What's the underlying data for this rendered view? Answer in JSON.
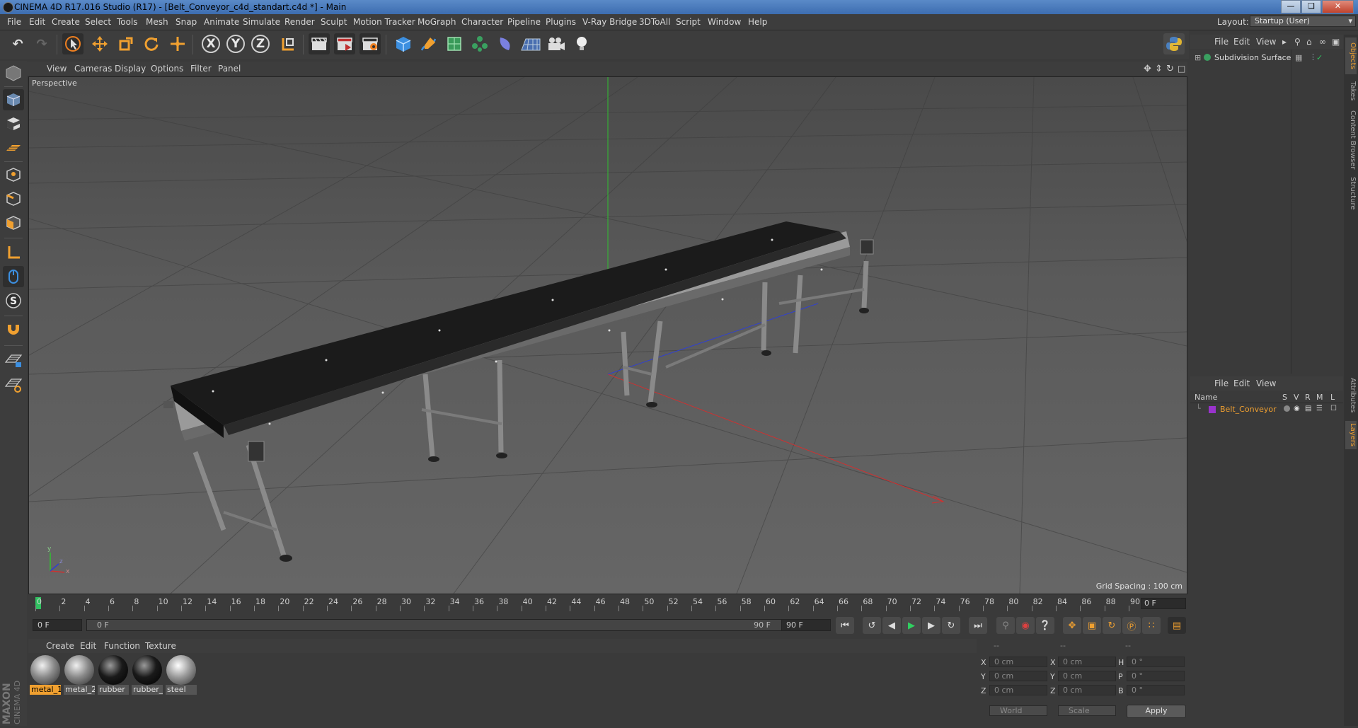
{
  "window": {
    "title": "CINEMA 4D R17.016 Studio (R17) - [Belt_Conveyor_c4d_standart.c4d *] - Main"
  },
  "menubar": {
    "items": [
      "File",
      "Edit",
      "Create",
      "Select",
      "Tools",
      "Mesh",
      "Snap",
      "Animate",
      "Simulate",
      "Render",
      "Sculpt",
      "Motion Tracker",
      "MoGraph",
      "Character",
      "Pipeline",
      "Plugins",
      "V-Ray Bridge",
      "3DToAll",
      "Script",
      "Window",
      "Help"
    ],
    "layout_label": "Layout:",
    "layout_value": "Startup (User)"
  },
  "toolbar": {
    "axis_labels": [
      "X",
      "Y",
      "Z"
    ]
  },
  "viewport": {
    "menu": [
      "View",
      "Cameras",
      "Display",
      "Options",
      "Filter",
      "Panel"
    ],
    "label": "Perspective",
    "grid_spacing": "Grid Spacing : 100 cm",
    "axis_gizmo": {
      "y": "y",
      "x": "x",
      "z": "z"
    }
  },
  "timeline": {
    "ticks": [
      "0",
      "2",
      "4",
      "6",
      "8",
      "10",
      "12",
      "14",
      "16",
      "18",
      "20",
      "22",
      "24",
      "26",
      "28",
      "30",
      "32",
      "34",
      "36",
      "38",
      "40",
      "42",
      "44",
      "46",
      "48",
      "50",
      "52",
      "54",
      "56",
      "58",
      "60",
      "62",
      "64",
      "66",
      "68",
      "70",
      "72",
      "74",
      "76",
      "78",
      "80",
      "82",
      "84",
      "86",
      "88",
      "90"
    ],
    "current_frame": "0 F"
  },
  "transport": {
    "start_field": "0 F",
    "range_start": "0 F",
    "range_end": "90 F",
    "end_field": "90 F"
  },
  "materials": {
    "menu": [
      "Create",
      "Edit",
      "Function",
      "Texture"
    ],
    "items": [
      {
        "label": "metal_1",
        "selected": true,
        "color": "#8a8a8a"
      },
      {
        "label": "metal_2",
        "selected": false,
        "color": "#8a8a8a"
      },
      {
        "label": "rubber",
        "selected": false,
        "color": "#1a1a1a"
      },
      {
        "label": "rubber_",
        "selected": false,
        "color": "#1a1a1a"
      },
      {
        "label": "steel",
        "selected": false,
        "color": "#9a9a9a"
      }
    ]
  },
  "coordinates": {
    "header": [
      "--",
      "--",
      "--"
    ],
    "rows": [
      {
        "a_label": "X",
        "a_val": "0 cm",
        "b_label": "X",
        "b_val": "0 cm",
        "c_label": "H",
        "c_val": "0 °"
      },
      {
        "a_label": "Y",
        "a_val": "0 cm",
        "b_label": "Y",
        "b_val": "0 cm",
        "c_label": "P",
        "c_val": "0 °"
      },
      {
        "a_label": "Z",
        "a_val": "0 cm",
        "b_label": "Z",
        "b_val": "0 cm",
        "c_label": "B",
        "c_val": "0 °"
      }
    ],
    "mode_world": "World",
    "mode_scale": "Scale",
    "apply": "Apply"
  },
  "objects": {
    "menu": [
      "File",
      "Edit",
      "View"
    ],
    "items": [
      {
        "name": "Subdivision Surface"
      }
    ]
  },
  "layers": {
    "menu": [
      "File",
      "Edit",
      "View"
    ],
    "columns": [
      "Name",
      "S",
      "V",
      "R",
      "M",
      "L"
    ],
    "items": [
      {
        "name": "Belt_Conveyor",
        "color": "#9933cc"
      }
    ]
  },
  "right_tabs": [
    "Objects",
    "Takes",
    "Content Browser",
    "Structure",
    "Attributes",
    "Layers"
  ],
  "logo": {
    "brand": "MAXON",
    "product": "CINEMA 4D"
  },
  "colors": {
    "accent": "#f0a030",
    "x_axis": "#d03030",
    "y_axis": "#30c030",
    "z_axis": "#3040d0"
  }
}
